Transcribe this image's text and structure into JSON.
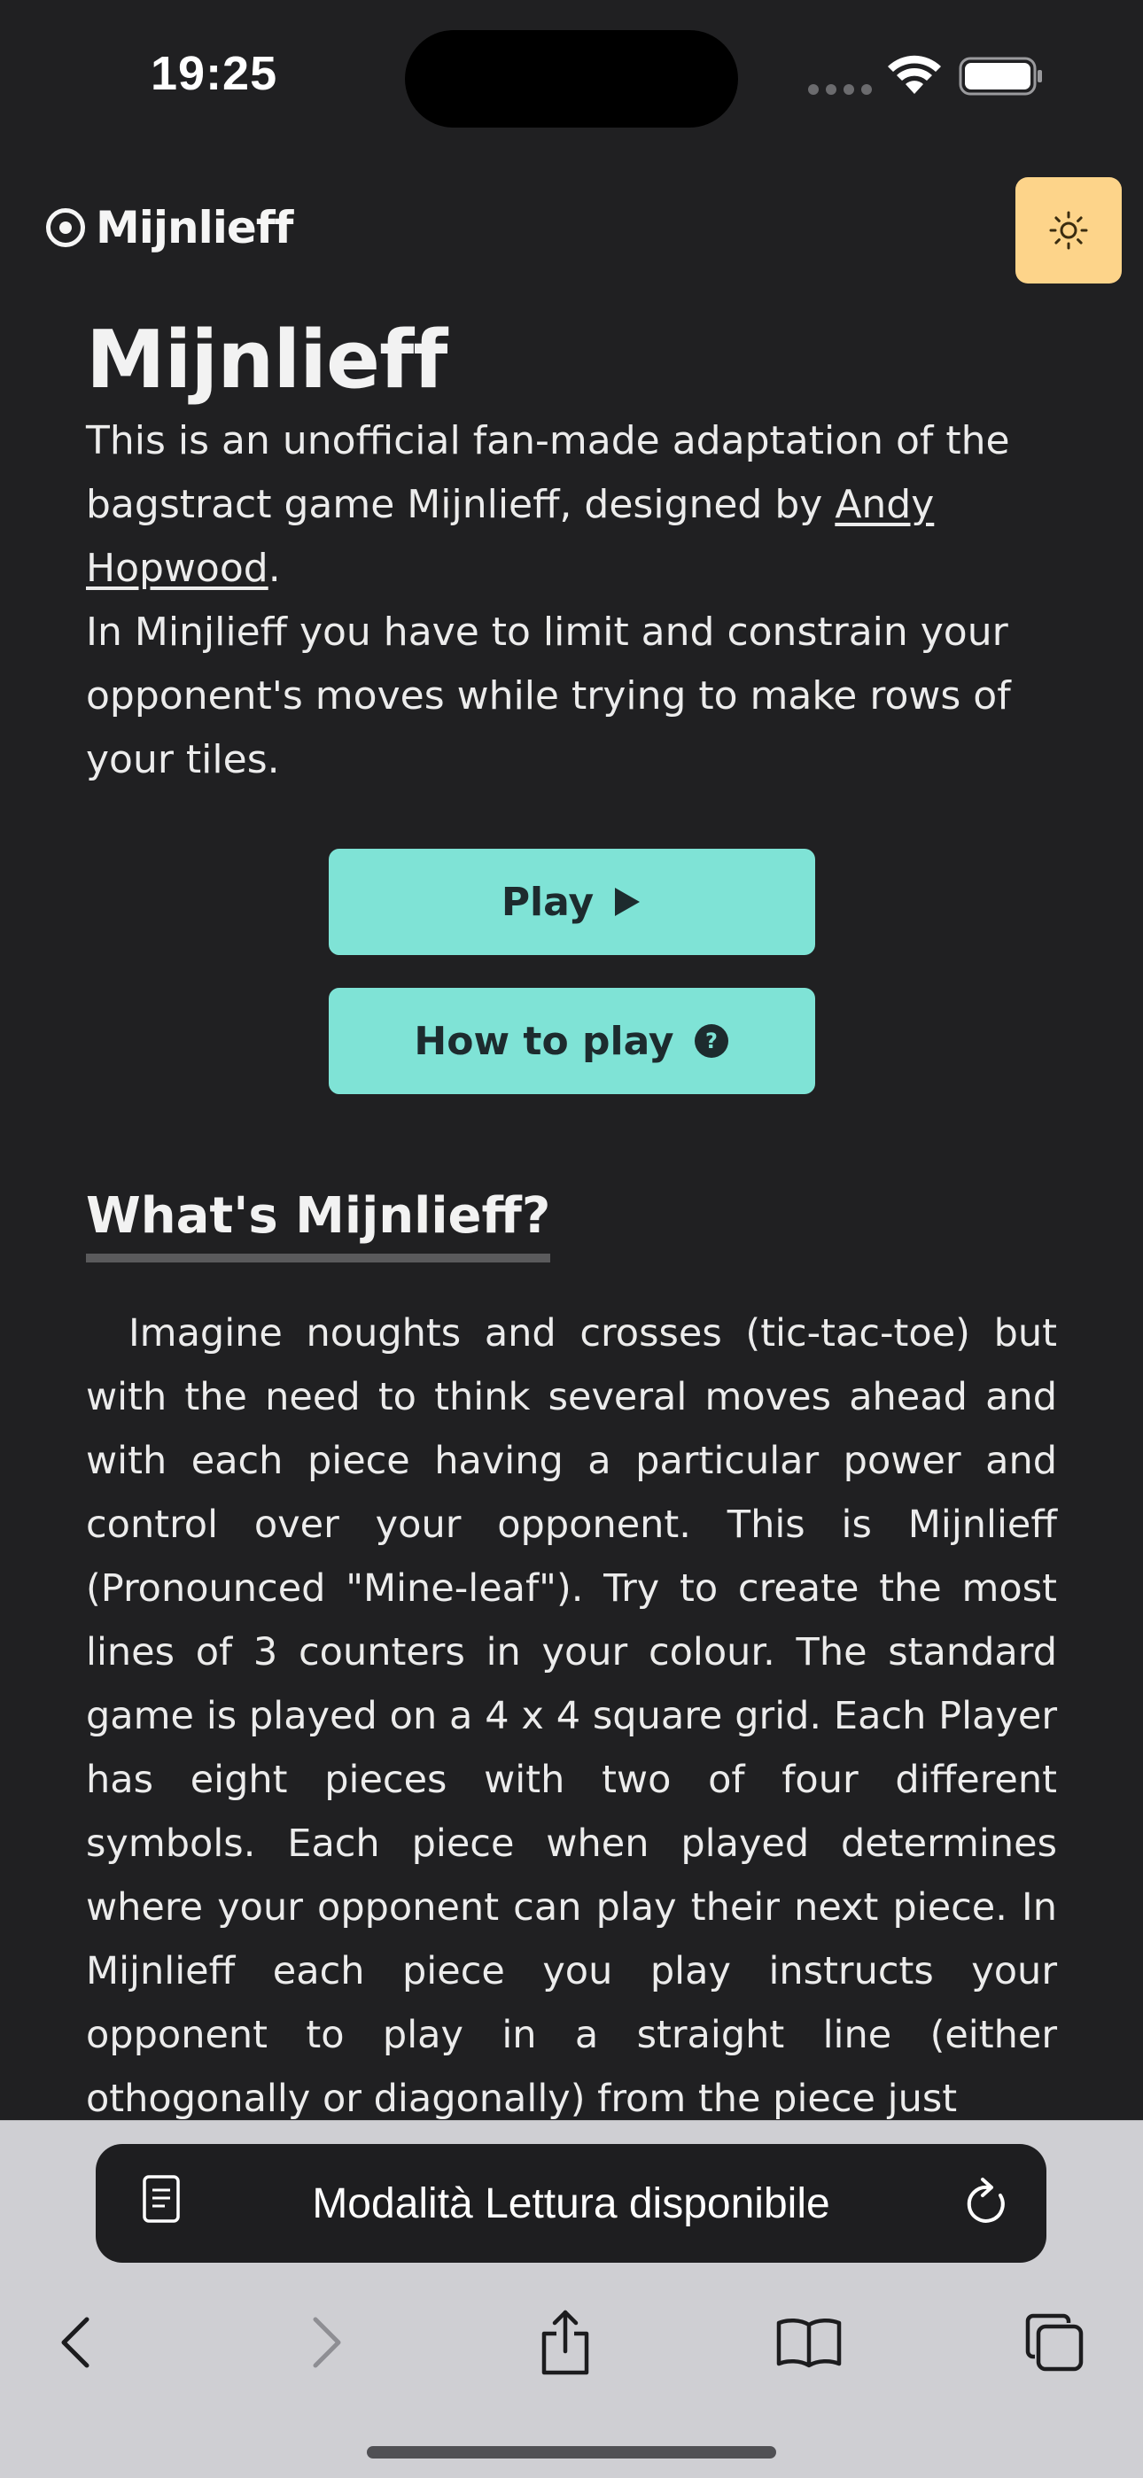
{
  "status_bar": {
    "time": "19:25"
  },
  "header": {
    "logo_text": "Mijnlieff",
    "theme_toggle_icon": "sun-icon"
  },
  "main": {
    "title": "Mijnlieff",
    "intro_part1": "This is an unofficial fan-made adaptation of the bagstract game Mijnlieff, designed by ",
    "designer_link": "Andy Hopwood",
    "intro_part2": ".",
    "intro_line2": "In Minjlieff you have to limit and constrain your opponent's moves while trying to make rows of your tiles.",
    "play_button": "Play",
    "howto_button": "How to play",
    "section_heading": "What's Mijnlieff?",
    "section_body": "Imagine noughts and crosses (tic-tac-toe) but with the need to think several moves ahead and with each piece having a particular power and control over your opponent. This is Mijnlieff (Pronounced \"Mine-leaf\"). Try to create the most lines of 3 counters in your colour. The standard game is played on a 4 x 4 square grid. Each Player has eight pieces with two of four different symbols. Each piece when played determines where your opponent can play their next piece. In Mijnlieff each piece you play instructs your opponent to play in a straight line (either othogonally or diagonally) from the piece just"
  },
  "safari": {
    "reader_text": "Modalità Lettura disponibile",
    "toolbar_icons": [
      "back-icon",
      "forward-icon",
      "share-icon",
      "bookmarks-icon",
      "tabs-icon"
    ]
  },
  "colors": {
    "background": "#202022",
    "accent_button": "#7fe3d6",
    "theme_toggle": "#fdd48a",
    "safari_chrome": "#cfcfd3"
  }
}
